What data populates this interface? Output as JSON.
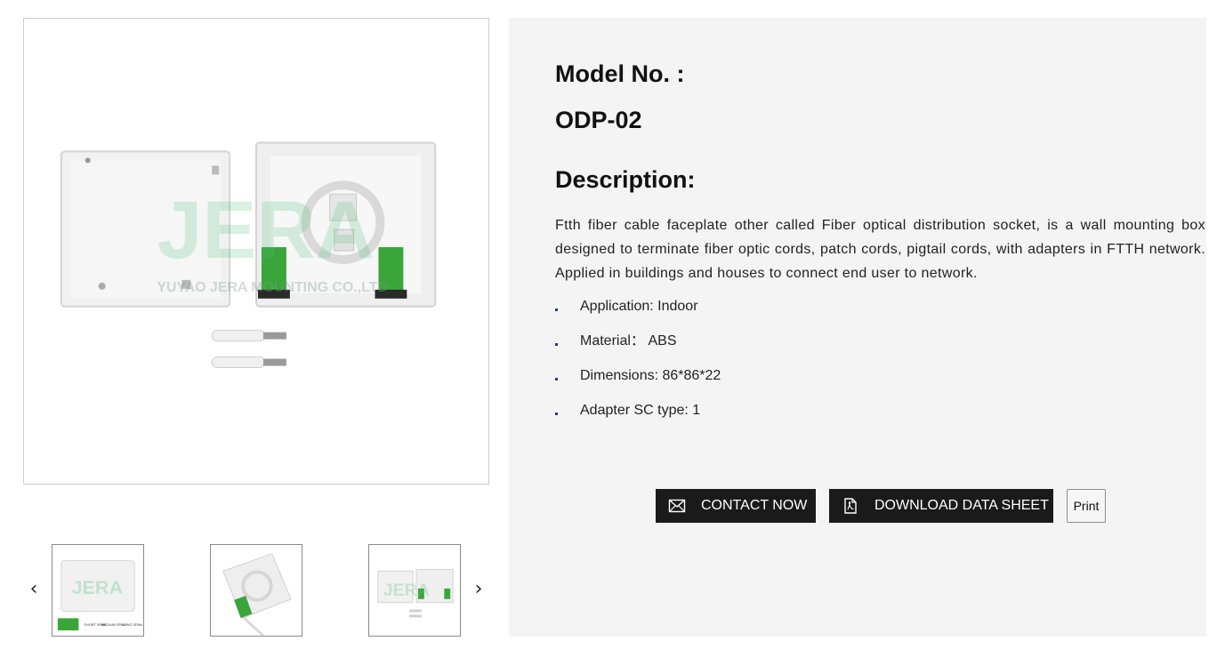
{
  "gallery": {
    "watermark_brand": "JERA",
    "watermark_company": "YUYAO JERA MOUNTING CO.,LTD",
    "prev_arrow": "‹",
    "next_arrow": "›",
    "thumbnails": [
      {
        "name": "thumb-1",
        "captions": [
          "SHORT SPAN",
          "MEDIUM SPAN",
          "LONG SPAN"
        ]
      },
      {
        "name": "thumb-2"
      },
      {
        "name": "thumb-3"
      }
    ]
  },
  "product": {
    "model_label": "Model No. :",
    "model_value": "ODP-02",
    "description_title": "Description:",
    "description_text": "Ftth fiber cable faceplate other called Fiber optical distribution socket, is a wall mounting box designed to terminate fiber optic cords, patch cords, pigtail cords, with adapters in FTTH network. Applied in buildings and houses to connect end user to network.",
    "specs": [
      "Application: Indoor",
      "Material：  ABS",
      "Dimensions: 86*86*22",
      "Adapter SC type:  1"
    ]
  },
  "actions": {
    "contact_label": "CONTACT NOW",
    "contact_icon": "envelope-icon",
    "download_label": "DOWNLOAD DATA SHEET",
    "download_icon": "pdf-file-icon",
    "print_label": "Print"
  },
  "colors": {
    "panel_bg": "#f4f4f4",
    "button_bg": "#1a1a1a",
    "bullet": "#1c3f8f",
    "adapter_green": "#3aa63a"
  }
}
